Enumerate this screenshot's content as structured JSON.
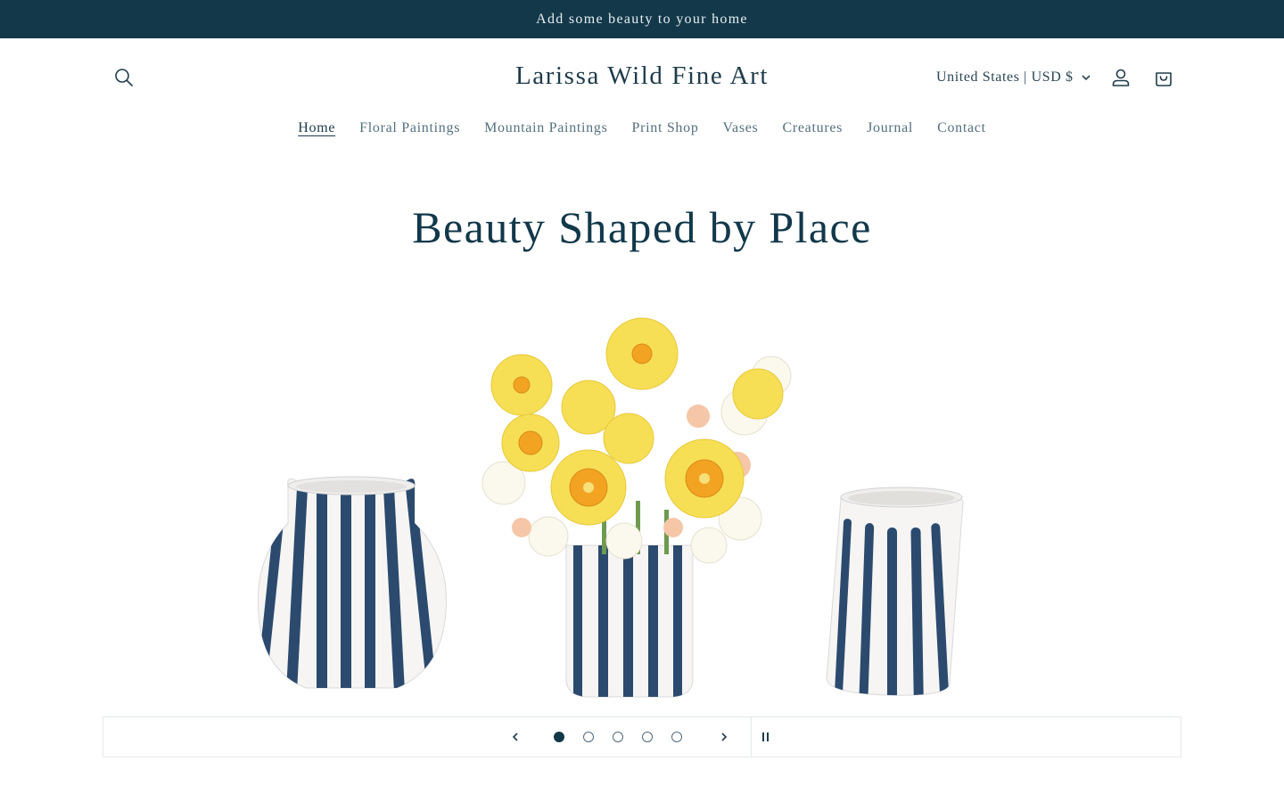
{
  "announcement": {
    "text": "Add some beauty to your home"
  },
  "header": {
    "logo": "Larissa Wild Fine Art",
    "localization": "United States | USD $",
    "icons": {
      "search": "search-icon",
      "account": "account-icon",
      "cart": "cart-icon",
      "chevron": "chevron-down-icon"
    }
  },
  "nav": {
    "items": [
      {
        "label": "Home",
        "active": true
      },
      {
        "label": "Floral Paintings"
      },
      {
        "label": "Mountain Paintings"
      },
      {
        "label": "Print Shop"
      },
      {
        "label": "Vases"
      },
      {
        "label": "Creatures"
      },
      {
        "label": "Journal"
      },
      {
        "label": "Contact"
      }
    ]
  },
  "hero": {
    "title": "Beauty Shaped by Place"
  },
  "slideshow": {
    "slide_count": 5,
    "current_slide": 1,
    "icons": {
      "prev": "chevron-left-icon",
      "next": "chevron-right-icon",
      "pause": "pause-icon"
    }
  },
  "colors": {
    "brand_dark": "#12384a",
    "text": "#1f3b4a",
    "nav_muted": "#55707e",
    "stripe_blue": "#2b4a6e",
    "daffodil_yellow": "#f4d94a",
    "daffodil_orange": "#f2a321"
  }
}
